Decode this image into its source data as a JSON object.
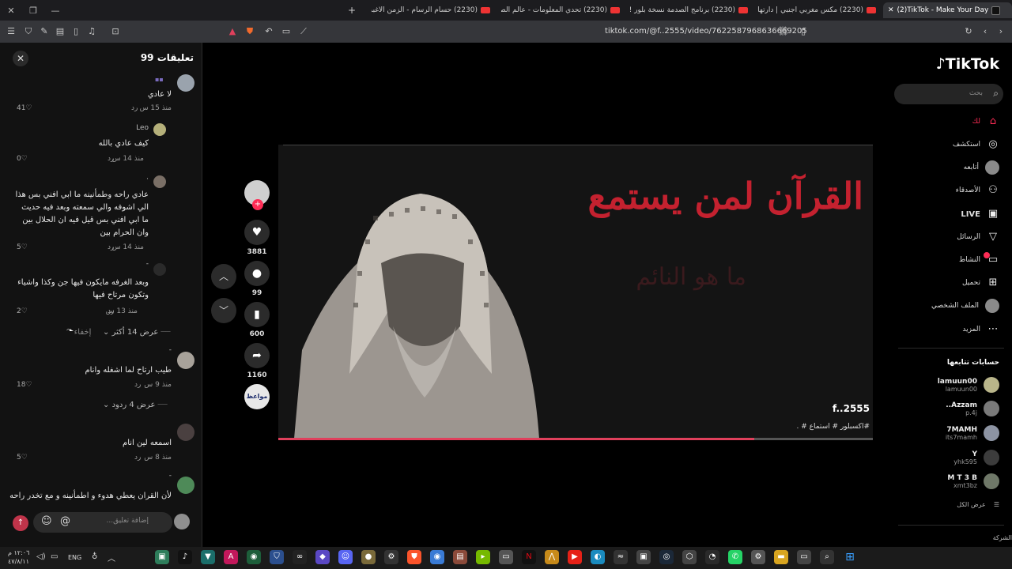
{
  "browser": {
    "tabs": [
      {
        "label": "(2)TikTok - Make Your Day",
        "active": true
      },
      {
        "label": "(2230) مكس مغربي اجنبي | دارتها لي ا"
      },
      {
        "label": "(2230) برنامج الصدمة نسخة بلور ! - be"
      },
      {
        "label": "(2230) تحدي المعلومات - عالم الصحابة"
      },
      {
        "label": "(2230) حسام الرسام - الزمن الاغبر (حصـ"
      }
    ],
    "new_tab": "+",
    "url": "tiktok.com/@f..2555/video/7622587968636669205"
  },
  "comments": {
    "title": "تعليقات 99",
    "close": "✕",
    "items": [
      {
        "user": "",
        "text": "لا عادي",
        "time": "منذ 15 س",
        "reply": "رد",
        "likes": "41"
      },
      {
        "user": "Leo",
        "text": "كيف عادي بالله",
        "time": "منذ 14 س",
        "reply": "رد",
        "likes": "0"
      },
      {
        "user": "·",
        "text_lines": [
          "عادي راحه وطمأنينه ما ابي افني بس هذا",
          "الي اشوفه والي سمعته وبعد فيه حديث",
          "ما ابي افني بس قيل فيه ان الحلال بين",
          "وان الحرام بين"
        ],
        "time": "منذ 14 س",
        "reply": "رد",
        "likes": "5"
      },
      {
        "user": "-",
        "text_lines": [
          "وبعد الغرفه مايكون فيها جن وكذا واشياء",
          "وتكون مرتاح فيها"
        ],
        "time": "منذ 13 س",
        "reply": "رد",
        "likes": "2"
      },
      {
        "user": "-",
        "text": "طيب ارتاح لما اشغله وانام",
        "time": "منذ 9 س",
        "reply": "رد",
        "likes": "18"
      },
      {
        "user": "",
        "text": "اسمعه لين انام",
        "time": "منذ 8 س",
        "reply": "رد",
        "likes": "5"
      },
      {
        "user": "-",
        "text": "لأن القران يعطي هدوء و اطمأنينه و مع تخدر راحه"
      }
    ],
    "show_more": "عرض 14 أكثر",
    "hide": "إخفاء",
    "show_replies": "عرض 4 ردود",
    "input_placeholder": "إضافة تعليق...",
    "at": "@",
    "emoji": "☺"
  },
  "video": {
    "title_text": "القرآن لمن يستمع",
    "faded_text": "ما هو النائم",
    "author": "f..2555",
    "description": "#اكسبلور # استماع # .",
    "progress": 0.8
  },
  "actions": {
    "likes": "3881",
    "comments": "99",
    "saves": "600",
    "shares": "1160",
    "music": "مواعظ"
  },
  "sidebar": {
    "logo": "TikTok",
    "search_placeholder": "بحث",
    "nav": [
      {
        "label": "لك",
        "icon": "home-icon"
      },
      {
        "label": "استكشف",
        "icon": "compass-icon"
      },
      {
        "label": "أتابعه",
        "icon": "following-icon"
      },
      {
        "label": "الأصدقاء",
        "icon": "friends-icon"
      },
      {
        "label": "LIVE",
        "icon": "live-icon"
      },
      {
        "label": "الرسائل",
        "icon": "messages-icon"
      },
      {
        "label": "النشاط",
        "icon": "activity-icon"
      },
      {
        "label": "تحميل",
        "icon": "upload-icon"
      },
      {
        "label": "الملف الشخصي",
        "icon": "profile-icon"
      },
      {
        "label": "المزيد",
        "icon": "more-icon"
      }
    ],
    "following_title": "حسابات تتابعها",
    "accounts": [
      {
        "name": "lamuun00",
        "handle": "lamuun00"
      },
      {
        "name": "..Azzam",
        "handle": "p.4j"
      },
      {
        "name": "7MAMH",
        "handle": "its7mamh"
      },
      {
        "name": "Y",
        "handle": "yhk595"
      },
      {
        "name": "M T 3 B",
        "handle": "xmt3bz"
      }
    ],
    "show_all": "عرض الكل",
    "company": "الشركة"
  },
  "taskbar": {
    "time": "١٢:٠٦ م",
    "date": "٤٧/٨/١١",
    "lang": "ENG"
  },
  "colors": {
    "accent": "#fe2c55",
    "video_title": "#c4212f"
  }
}
